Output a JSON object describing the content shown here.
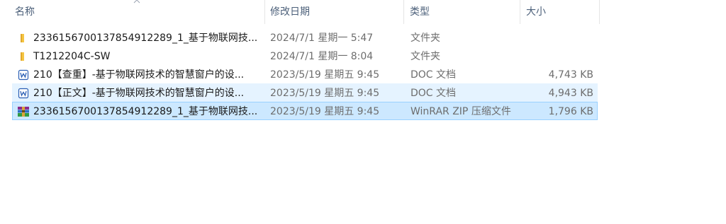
{
  "columns": {
    "name": "名称",
    "date": "修改日期",
    "type": "类型",
    "size": "大小"
  },
  "files": [
    {
      "icon": "folder-icon",
      "name": "2336156700137854912289_1_基于物联网技...",
      "date": "2024/7/1 星期一 5:47",
      "type": "文件夹",
      "size": ""
    },
    {
      "icon": "folder-icon",
      "name": "T1212204C-SW",
      "date": "2024/7/1 星期一 8:04",
      "type": "文件夹",
      "size": ""
    },
    {
      "icon": "word-doc-icon",
      "name": "210【查重】-基于物联网技术的智慧窗户的设...",
      "date": "2023/5/19 星期五 9:45",
      "type": "DOC 文档",
      "size": "4,743 KB"
    },
    {
      "icon": "word-doc-icon",
      "name": "210【正文】-基于物联网技术的智慧窗户的设...",
      "date": "2023/5/19 星期五 9:45",
      "type": "DOC 文档",
      "size": "4,943 KB"
    },
    {
      "icon": "winrar-archive-icon",
      "name": "2336156700137854912289_1_基于物联网技...",
      "date": "2023/5/19 星期五 9:45",
      "type": "WinRAR ZIP 压缩文件",
      "size": "1,796 KB"
    }
  ],
  "colors": {
    "header_text": "#4c607a",
    "hover_row": "#e5f3ff",
    "selected_row": "#cce8ff",
    "selected_border": "#99d1ff",
    "folder": "#f5c542"
  }
}
